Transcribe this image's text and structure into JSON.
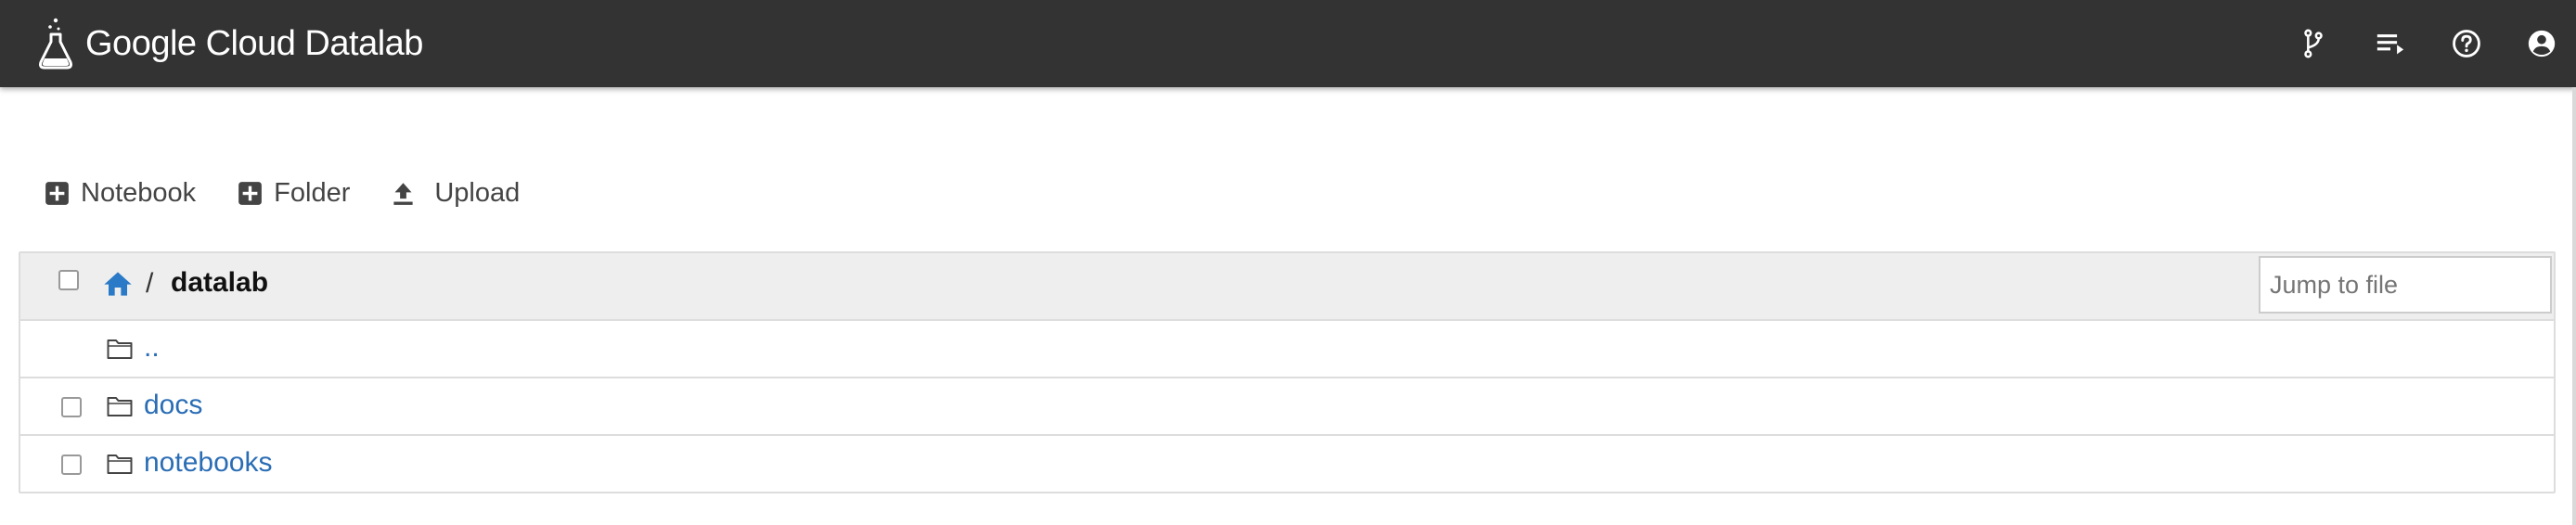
{
  "header": {
    "brand": "Google Cloud Datalab",
    "logo_icon": "flask-icon",
    "icons": [
      "git-branch-icon",
      "queue-icon",
      "help-icon",
      "account-icon"
    ]
  },
  "toolbar": {
    "notebook_label": "Notebook",
    "folder_label": "Folder",
    "upload_label": "Upload"
  },
  "breadcrumb": {
    "separator": "/",
    "current": "datalab"
  },
  "search": {
    "placeholder": "Jump to file"
  },
  "files": [
    {
      "name": "..",
      "type": "folder",
      "checkbox": false
    },
    {
      "name": "docs",
      "type": "folder",
      "checkbox": true
    },
    {
      "name": "notebooks",
      "type": "folder",
      "checkbox": true
    }
  ],
  "colors": {
    "topbar": "#333333",
    "link": "#2a6db5",
    "home_icon": "#2a7ac7",
    "header_row": "#eeeeee"
  }
}
